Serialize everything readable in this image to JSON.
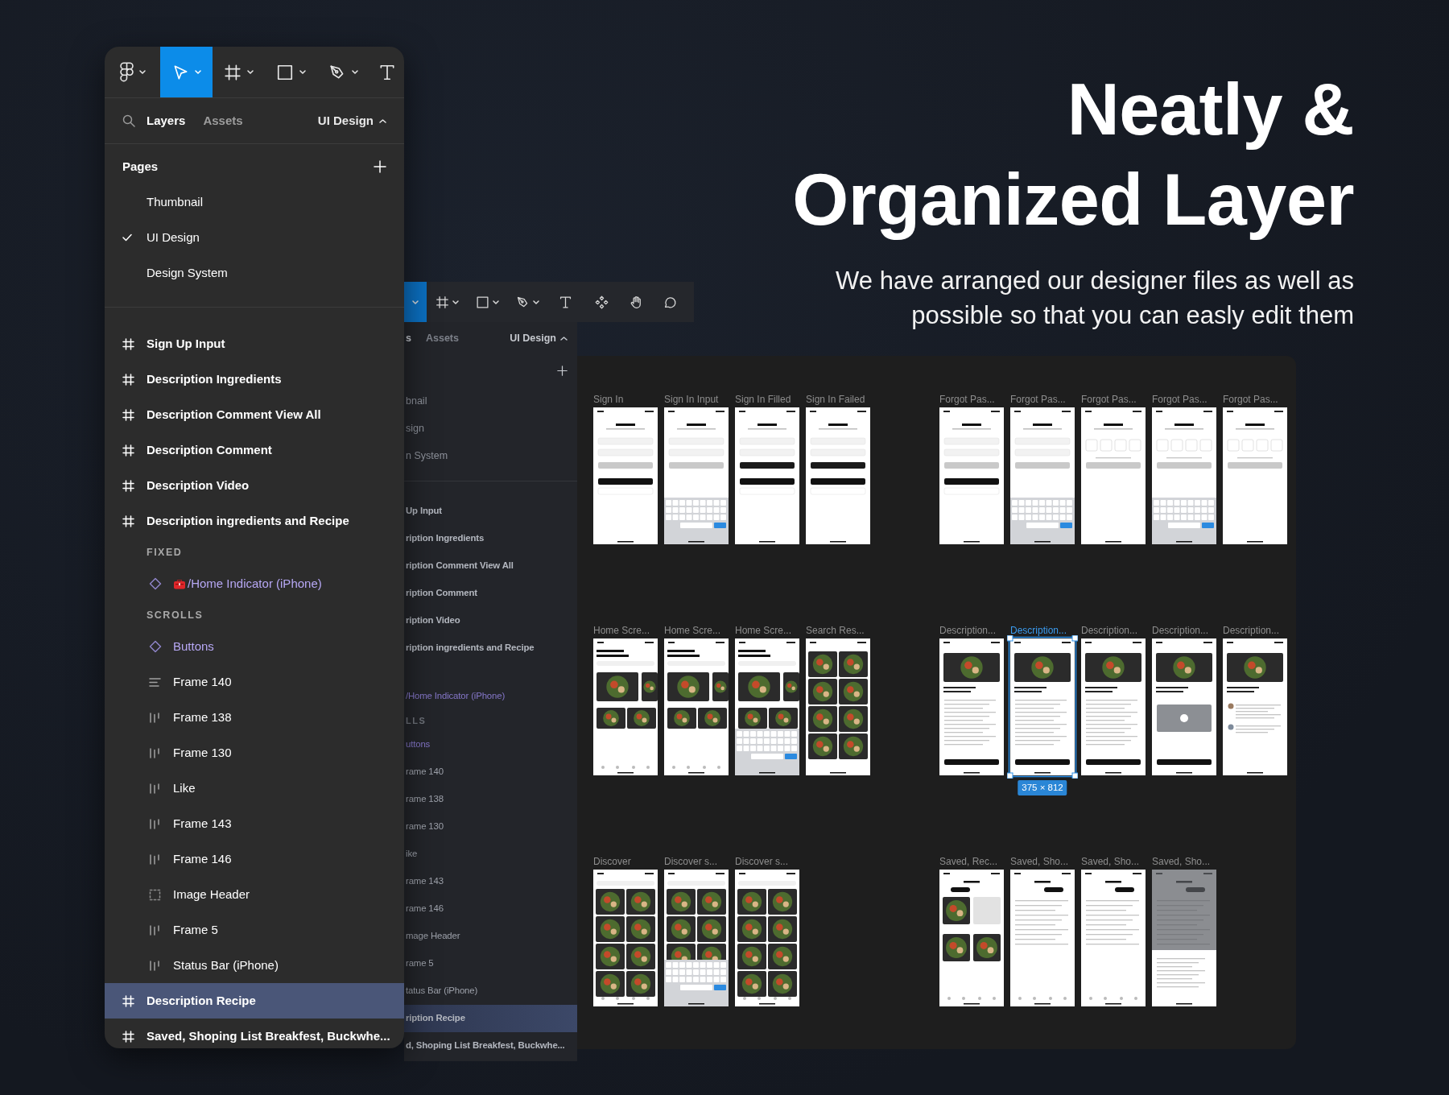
{
  "headline": "Neatly & Organized Layer",
  "subheadline": "We have arranged our designer files as well as possible so that you can easly edit them",
  "layers_panel": {
    "tools": [
      {
        "kind": "logo",
        "selected": false
      },
      {
        "kind": "move",
        "selected": true
      },
      {
        "kind": "frame",
        "selected": false
      },
      {
        "kind": "shape",
        "selected": false
      },
      {
        "kind": "pen",
        "selected": false
      },
      {
        "kind": "text",
        "selected": false
      }
    ],
    "tabs": [
      {
        "label": "Layers",
        "selected": true
      },
      {
        "label": "Assets",
        "selected": false
      }
    ],
    "page_picker": "UI Design",
    "pages_title": "Pages",
    "pages": [
      {
        "label": "Thumbnail",
        "checked": false
      },
      {
        "label": "UI Design",
        "checked": true
      },
      {
        "label": "Design System",
        "checked": false
      }
    ],
    "layers": [
      {
        "label": "Sign Up Input",
        "kind": "frame",
        "selected": false
      },
      {
        "label": "Description Ingredients",
        "kind": "frame",
        "selected": false
      },
      {
        "label": "Description Comment View All",
        "kind": "frame",
        "selected": false
      },
      {
        "label": "Description Comment",
        "kind": "frame",
        "selected": false
      },
      {
        "label": "Description Video",
        "kind": "frame",
        "selected": false
      },
      {
        "label": "Description ingredients and Recipe",
        "kind": "frame",
        "selected": false,
        "children": [
          {
            "label": "FIXED",
            "kind": "section"
          },
          {
            "label": "/Home Indicator (iPhone)",
            "kind": "library-instance",
            "selected": false
          },
          {
            "label": "SCROLLS",
            "kind": "section"
          },
          {
            "label": "Buttons",
            "kind": "instance",
            "selected": false
          },
          {
            "label": "Frame 140",
            "kind": "stack-v",
            "selected": false
          },
          {
            "label": "Frame 138",
            "kind": "stack-h",
            "selected": false
          },
          {
            "label": "Frame 130",
            "kind": "stack-h",
            "selected": false
          },
          {
            "label": "Like",
            "kind": "stack-h",
            "selected": false
          },
          {
            "label": "Frame 143",
            "kind": "stack-h",
            "selected": false
          },
          {
            "label": "Frame 146",
            "kind": "stack-h",
            "selected": false
          },
          {
            "label": "Image Header",
            "kind": "group",
            "selected": false
          },
          {
            "label": "Frame 5",
            "kind": "stack-h",
            "selected": false
          },
          {
            "label": "Status Bar (iPhone)",
            "kind": "stack-h",
            "selected": false
          }
        ]
      },
      {
        "label": "Description Recipe",
        "kind": "frame",
        "selected": true
      },
      {
        "label": "Saved, Shoping List Breakfest, Buckwhe...",
        "kind": "frame",
        "selected": false
      }
    ]
  },
  "back_window": {
    "tools": [
      {
        "kind": "move",
        "selected": true
      },
      {
        "kind": "frame",
        "selected": false
      },
      {
        "kind": "shape",
        "selected": false
      },
      {
        "kind": "pen",
        "selected": false
      },
      {
        "kind": "text",
        "selected": false
      },
      {
        "kind": "components",
        "selected": false
      },
      {
        "kind": "hand",
        "selected": false
      },
      {
        "kind": "comment",
        "selected": false
      }
    ],
    "tabs": [
      {
        "label": "s",
        "selected": true
      },
      {
        "label": "Assets",
        "selected": false
      }
    ],
    "page_picker": "UI Design",
    "pages": [
      {
        "label": "bnail"
      },
      {
        "label": "sign"
      },
      {
        "label": "n System"
      }
    ],
    "layers": [
      {
        "label": "Up Input",
        "kind": "frame",
        "selected": false
      },
      {
        "label": "ription Ingredients",
        "kind": "frame",
        "selected": false
      },
      {
        "label": "ription Comment View All",
        "kind": "frame",
        "selected": false
      },
      {
        "label": "ription Comment",
        "kind": "frame",
        "selected": false
      },
      {
        "label": "ription Video",
        "kind": "frame",
        "selected": false
      },
      {
        "label": "ription ingredients and Recipe",
        "kind": "frame",
        "selected": false,
        "children": [
          {
            "label": "/Home Indicator (iPhone)",
            "kind": "library-instance",
            "selected": false
          },
          {
            "label": "LLS",
            "kind": "section"
          },
          {
            "label": "uttons",
            "kind": "instance",
            "selected": false
          },
          {
            "label": "rame 140",
            "kind": "stack-v",
            "selected": false
          },
          {
            "label": "rame 138",
            "kind": "stack-h",
            "selected": false
          },
          {
            "label": "rame 130",
            "kind": "stack-h",
            "selected": false
          },
          {
            "label": "ike",
            "kind": "stack-h",
            "selected": false
          },
          {
            "label": "rame 143",
            "kind": "stack-h",
            "selected": false
          },
          {
            "label": "rame 146",
            "kind": "stack-h",
            "selected": false
          },
          {
            "label": "mage Header",
            "kind": "group",
            "selected": false
          },
          {
            "label": "rame 5",
            "kind": "stack-h",
            "selected": false
          },
          {
            "label": "tatus Bar (iPhone)",
            "kind": "stack-h",
            "selected": false
          }
        ]
      },
      {
        "label": "ription Recipe",
        "kind": "frame",
        "selected": true
      },
      {
        "label": "d, Shoping List Breakfest, Buckwhe...",
        "kind": "frame",
        "selected": false
      }
    ],
    "canvas": {
      "groups": [
        {
          "rows": [
            {
              "frames": [
                {
                  "label": "Sign In",
                  "kind": "form",
                  "selected": false
                },
                {
                  "label": "Sign In Input",
                  "kind": "form-keys",
                  "selected": false
                },
                {
                  "label": "Sign In Filled",
                  "kind": "form-filled",
                  "selected": false
                },
                {
                  "label": "Sign In Failed",
                  "kind": "form-filled",
                  "selected": false
                }
              ]
            },
            {
              "frames": [
                {
                  "label": "Home Scre...",
                  "kind": "feed",
                  "selected": false
                },
                {
                  "label": "Home Scre...",
                  "kind": "feed",
                  "selected": false
                },
                {
                  "label": "Home Scre...",
                  "kind": "feed-keys",
                  "selected": false
                },
                {
                  "label": "Search Res...",
                  "kind": "results",
                  "selected": false
                }
              ]
            },
            {
              "frames": [
                {
                  "label": "Discover",
                  "kind": "discover",
                  "selected": false
                },
                {
                  "label": "Discover s...",
                  "kind": "discover-keys",
                  "selected": false
                },
                {
                  "label": "Discover s...",
                  "kind": "discover",
                  "selected": false
                }
              ]
            }
          ]
        },
        {
          "rows": [
            {
              "frames": [
                {
                  "label": "Forgot Pas...",
                  "kind": "form",
                  "selected": false
                },
                {
                  "label": "Forgot Pas...",
                  "kind": "form-keys",
                  "selected": false
                },
                {
                  "label": "Forgot Pas...",
                  "kind": "otp",
                  "selected": false
                },
                {
                  "label": "Forgot Pas...",
                  "kind": "otp-keys",
                  "selected": false
                },
                {
                  "label": "Forgot Pas...",
                  "kind": "otp",
                  "selected": false
                }
              ]
            },
            {
              "frames": [
                {
                  "label": "Description...",
                  "kind": "recipe",
                  "selected": false
                },
                {
                  "label": "Description...",
                  "kind": "recipe",
                  "selected": true,
                  "size": "375 × 812"
                },
                {
                  "label": "Description...",
                  "kind": "recipe",
                  "selected": false
                },
                {
                  "label": "Description...",
                  "kind": "video",
                  "selected": false
                },
                {
                  "label": "Description...",
                  "kind": "comments",
                  "selected": false
                }
              ]
            },
            {
              "frames": [
                {
                  "label": "Saved, Rec...",
                  "kind": "saved-grid",
                  "selected": false
                },
                {
                  "label": "Saved, Sho...",
                  "kind": "saved-list",
                  "selected": false
                },
                {
                  "label": "Saved, Sho...",
                  "kind": "saved-list",
                  "selected": false
                },
                {
                  "label": "Saved, Sho...",
                  "kind": "saved-sheet",
                  "selected": false
                }
              ]
            }
          ]
        }
      ]
    }
  }
}
